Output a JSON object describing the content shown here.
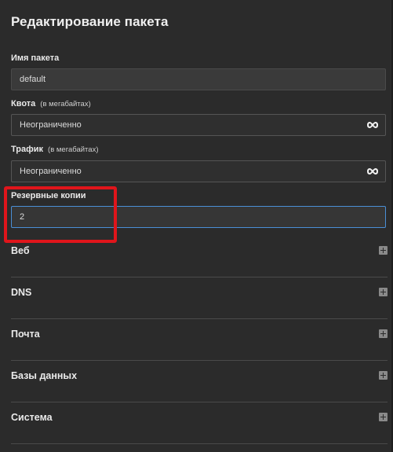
{
  "page": {
    "title": "Редактирование пакета"
  },
  "fields": {
    "package_name": {
      "label": "Имя пакета",
      "value": "default"
    },
    "quota": {
      "label": "Квота",
      "hint": "(в мегабайтах)",
      "value": "Неограниченно",
      "icon": "infinity-icon"
    },
    "traffic": {
      "label": "Трафик",
      "hint": "(в мегабайтах)",
      "value": "Неограниченно",
      "icon": "infinity-icon"
    },
    "backups": {
      "label": "Резервные копии",
      "value": "2"
    }
  },
  "sections": [
    {
      "label": "Веб",
      "icon": "expand-plus-icon"
    },
    {
      "label": "DNS",
      "icon": "expand-plus-icon"
    },
    {
      "label": "Почта",
      "icon": "expand-plus-icon"
    },
    {
      "label": "Базы данных",
      "icon": "expand-plus-icon"
    },
    {
      "label": "Система",
      "icon": "expand-plus-icon"
    }
  ],
  "colors": {
    "background": "#2b2b2b",
    "input_background": "#3a3a3a",
    "focus_border": "#4a8fd6",
    "highlight": "#e0151b"
  }
}
